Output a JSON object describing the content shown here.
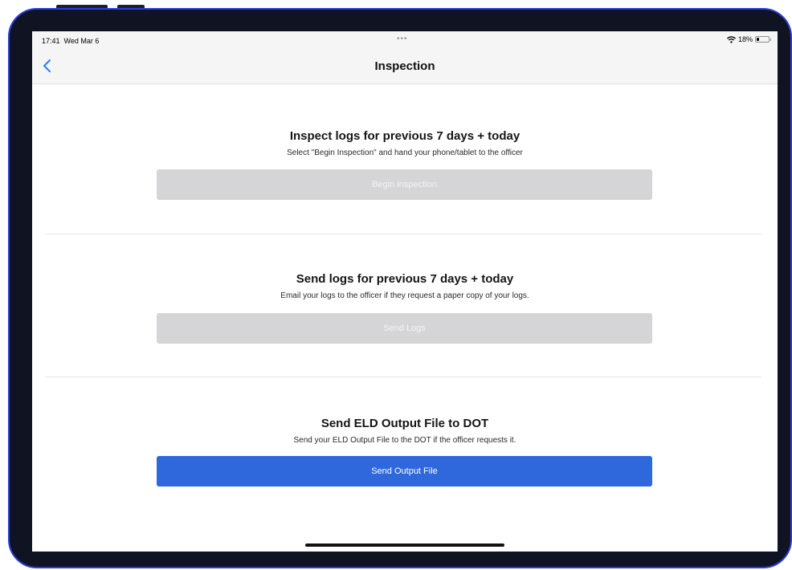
{
  "status_bar": {
    "time": "17:41",
    "date": "Wed Mar 6",
    "dots": "•••",
    "battery_percent": "18%",
    "battery_level": 0.18,
    "wifi_icon": "wifi-icon",
    "battery_icon": "battery-icon"
  },
  "nav": {
    "title": "Inspection",
    "back_icon": "chevron-left-icon"
  },
  "sections": [
    {
      "title": "Inspect logs for previous 7 days + today",
      "description": "Select \"Begin Inspection\" and hand your phone/tablet to the officer",
      "button_label": "Begin inspection",
      "button_enabled": false
    },
    {
      "title": "Send logs for previous 7 days + today",
      "description": "Email your logs to the officer if they request a paper copy of your logs.",
      "button_label": "Send Logs",
      "button_enabled": false
    },
    {
      "title": "Send ELD Output File to DOT",
      "description": "Send your ELD Output File to the DOT if the officer requests it.",
      "button_label": "Send Output File",
      "button_enabled": true
    }
  ],
  "colors": {
    "accent": "#2f68dd",
    "back_chevron": "#2f7cf6",
    "disabled_button": "#d5d5d7",
    "bezel_border": "#2a3fd8"
  }
}
